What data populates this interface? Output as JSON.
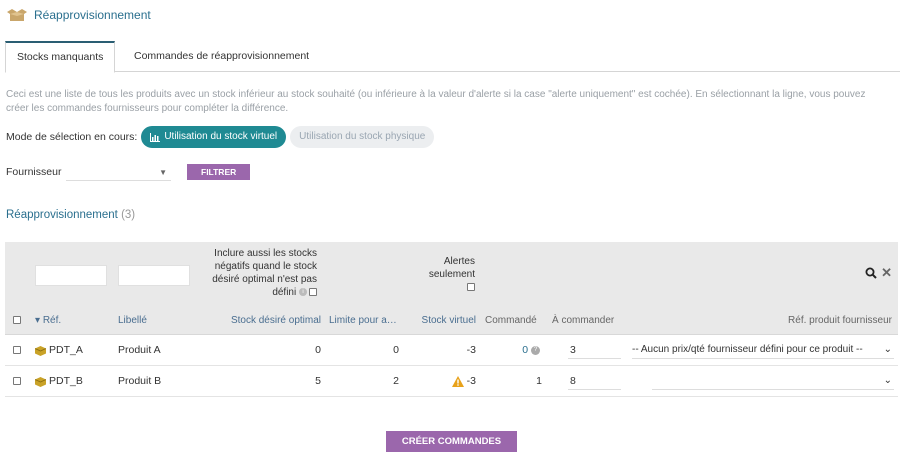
{
  "header": {
    "title": "Réapprovisionnement",
    "icon": "boxes-icon"
  },
  "tabs": [
    {
      "label": "Stocks manquants",
      "active": true
    },
    {
      "label": "Commandes de réapprovisionnement",
      "active": false
    }
  ],
  "description": "Ceci est une liste de tous les produits avec un stock inférieur au stock souhaité (ou inférieure à la valeur d'alerte si la case \"alerte uniquement\" est cochée). En sélectionnant la ligne, vous pouvez créer les commandes fournisseurs pour compléter la différence.",
  "mode": {
    "label": "Mode de sélection en cours:",
    "virtual": "Utilisation du stock virtuel",
    "physical": "Utilisation du stock physique"
  },
  "supplier": {
    "label": "Fournisseur",
    "value": "",
    "filter_button": "FILTRER"
  },
  "section": {
    "title": "Réapprovisionnement",
    "count": "(3)"
  },
  "filters": {
    "include_negative": "Inclure aussi les stocks négatifs quand le stock désiré optimal n'est pas défini",
    "alerts_only": "Alertes seulement"
  },
  "columns": {
    "ref": "Réf.",
    "label": "Libellé",
    "desired": "Stock désiré optimal",
    "limit": "Limite pour a…",
    "virtual": "Stock virtuel",
    "ordered": "Commandé",
    "to_order": "À commander",
    "supplier_ref": "Réf. produit fournisseur"
  },
  "rows": [
    {
      "ref": "PDT_A",
      "label": "Produit A",
      "desired": "0",
      "limit": "0",
      "virtual": "-3",
      "ordered": "0",
      "to_order": "3",
      "supplier_ref": "-- Aucun prix/qté fournisseur défini pour ce produit --",
      "warning": false
    },
    {
      "ref": "PDT_B",
      "label": "Produit B",
      "desired": "5",
      "limit": "2",
      "virtual": "-3",
      "ordered": "1",
      "to_order": "8",
      "supplier_ref": "",
      "warning": true
    }
  ],
  "create_button": "CRÉER COMMANDES",
  "colors": {
    "accent": "#2a6f8e",
    "teal": "#1f8a93",
    "purple": "#9b67ac",
    "warning": "#e8a21b"
  }
}
